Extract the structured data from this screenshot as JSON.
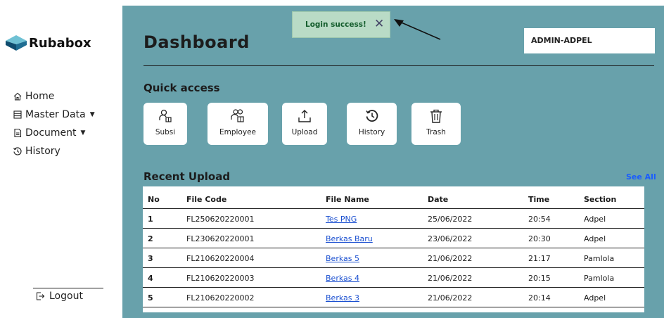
{
  "sidebar": {
    "brand": "Rubabox",
    "items": [
      {
        "label": "Home",
        "icon": "home-icon",
        "caret": false
      },
      {
        "label": "Master Data",
        "icon": "table-icon",
        "caret": true
      },
      {
        "label": "Document",
        "icon": "document-icon",
        "caret": true
      },
      {
        "label": "History",
        "icon": "history-icon",
        "caret": false
      }
    ],
    "logout": "Logout"
  },
  "header": {
    "title": "Dashboard",
    "user": "ADMIN-ADPEL"
  },
  "toast": {
    "message": "Login success!",
    "close": "✕"
  },
  "quick_access": {
    "title": "Quick access",
    "tiles": [
      {
        "label": "Subsi",
        "icon": "user-box-icon"
      },
      {
        "label": "Employee",
        "icon": "users-box-icon"
      },
      {
        "label": "Upload",
        "icon": "upload-icon"
      },
      {
        "label": "History",
        "icon": "history-icon"
      },
      {
        "label": "Trash",
        "icon": "trash-icon"
      }
    ]
  },
  "recent": {
    "title": "Recent Upload",
    "see_all": "See All",
    "columns": [
      "No",
      "File Code",
      "File Name",
      "Date",
      "Time",
      "Section"
    ],
    "rows": [
      [
        "1",
        "FL250620220001",
        "Tes PNG",
        "25/06/2022",
        "20:54",
        "Adpel"
      ],
      [
        "2",
        "FL230620220001",
        "Berkas Baru",
        "23/06/2022",
        "20:30",
        "Adpel"
      ],
      [
        "3",
        "FL210620220004",
        "Berkas 5",
        "21/06/2022",
        "21:17",
        "Pamlola"
      ],
      [
        "4",
        "FL210620220003",
        "Berkas 4",
        "21/06/2022",
        "20:15",
        "Pamlola"
      ],
      [
        "5",
        "FL210620220002",
        "Berkas 3",
        "21/06/2022",
        "20:14",
        "Adpel"
      ]
    ]
  },
  "colors": {
    "main_bg": "#68a1ab",
    "toast_bg": "#b9dbc6",
    "link": "#1a4fd0",
    "see_all": "#1a5cff"
  }
}
